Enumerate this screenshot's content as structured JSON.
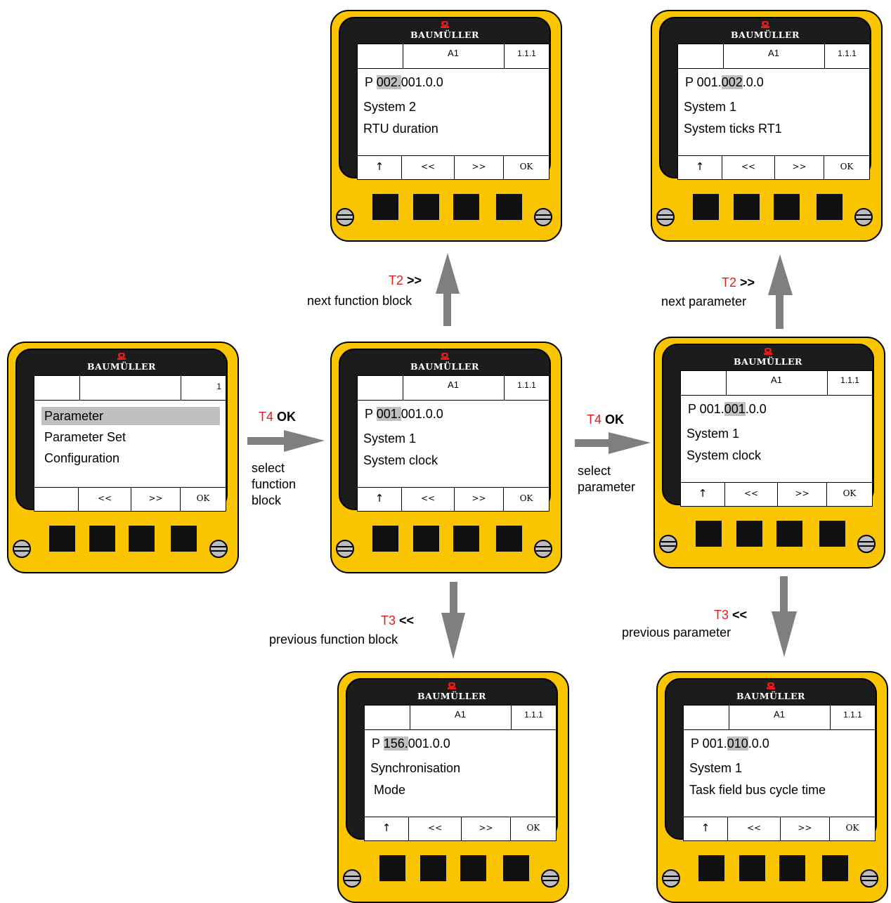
{
  "brand": "BAUMÜLLER",
  "colors": {
    "device_body": "#f9c500",
    "bezel": "#1c1c1c",
    "highlight": "#c0c0c0",
    "logo_mark": "#e21b1b",
    "key_label": "#e21b1b",
    "arrow": "#7f7f7f"
  },
  "devices": {
    "menu": {
      "header": [
        "",
        "",
        "1"
      ],
      "items": [
        "Parameter",
        "Parameter Set",
        "Configuration"
      ],
      "selected": "Parameter",
      "footer": [
        "",
        "<<",
        ">>",
        "OK"
      ]
    },
    "fb_center": {
      "header": [
        "",
        "A1",
        "1.1.1"
      ],
      "p_prefix": "P ",
      "p_hl": "001.",
      "p_rest": "001.0.0",
      "line2": "System 1",
      "line3": "System clock",
      "footer": [
        "↑",
        "<<",
        ">>",
        "OK"
      ]
    },
    "fb_next": {
      "header": [
        "",
        "A1",
        "1.1.1"
      ],
      "p_prefix": "P ",
      "p_hl": "002.",
      "p_rest": "001.0.0",
      "line2": "System 2",
      "line3": "RTU duration",
      "footer": [
        "↑",
        "<<",
        ">>",
        "OK"
      ]
    },
    "fb_prev": {
      "header": [
        "",
        "A1",
        "1.1.1"
      ],
      "p_prefix": "P ",
      "p_hl": "156.",
      "p_rest": "001.0.0",
      "line2": "Synchronisation",
      "line3": " Mode",
      "footer": [
        "↑",
        "<<",
        ">>",
        "OK"
      ]
    },
    "par_center": {
      "header": [
        "",
        "A1",
        "1.1.1"
      ],
      "p_prefix": "P 001.",
      "p_hl": "001",
      "p_rest": ".0.0",
      "line2": "System 1",
      "line3": "System clock",
      "footer": [
        "↑",
        "<<",
        ">>",
        "OK"
      ]
    },
    "par_next": {
      "header": [
        "",
        "A1",
        "1.1.1"
      ],
      "p_prefix": "P 001.",
      "p_hl": "002",
      "p_rest": ".0.0",
      "line2": "System 1",
      "line3": "System ticks RT1",
      "footer": [
        "↑",
        "<<",
        ">>",
        "OK"
      ]
    },
    "par_prev": {
      "header": [
        "",
        "A1",
        "1.1.1"
      ],
      "p_prefix": "P 001.",
      "p_hl": "010",
      "p_rest": ".0.0",
      "line2": "System 1",
      "line3": "Task field bus cycle time",
      "footer": [
        "↑",
        "<<",
        ">>",
        "OK"
      ]
    }
  },
  "transitions": {
    "select_fb": {
      "key": "T4",
      "action": "OK",
      "desc": [
        "select",
        "function",
        "block"
      ]
    },
    "next_fb": {
      "key": "T2",
      "action": ">>",
      "desc": "next function block"
    },
    "prev_fb": {
      "key": "T3",
      "action": "<<",
      "desc": "previous function block"
    },
    "select_par": {
      "key": "T4",
      "action": "OK",
      "desc": [
        "select",
        "parameter"
      ]
    },
    "next_par": {
      "key": "T2",
      "action": ">>",
      "desc": "next parameter"
    },
    "prev_par": {
      "key": "T3",
      "action": "<<",
      "desc": "previous parameter"
    }
  }
}
